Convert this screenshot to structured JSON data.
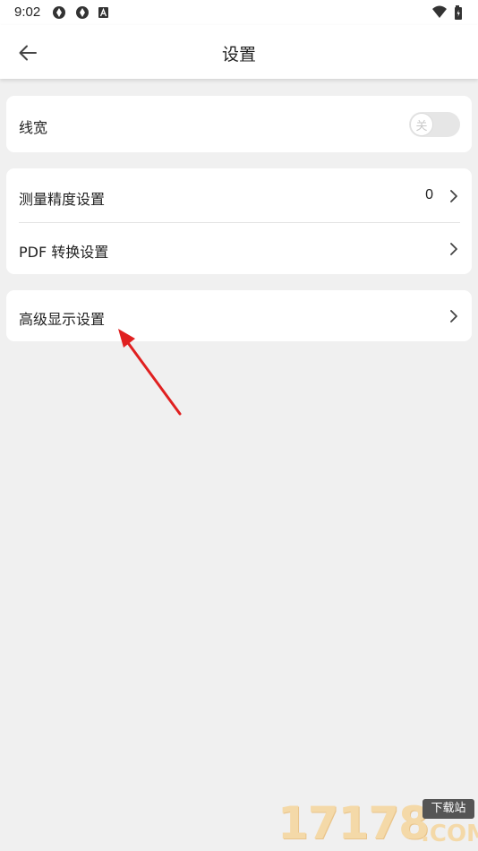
{
  "status_bar": {
    "time": "9:02",
    "icons": [
      "sync-icon",
      "sync-icon",
      "font-icon"
    ],
    "right_icons": [
      "wifi-icon",
      "battery-icon"
    ]
  },
  "app_bar": {
    "back_icon": "arrow-left-icon",
    "title": "设置"
  },
  "groups": [
    {
      "rows": [
        {
          "label": "线宽",
          "control": "toggle",
          "toggle_label": "关",
          "toggle_on": false
        }
      ]
    },
    {
      "rows": [
        {
          "label": "测量精度设置",
          "value": "0",
          "control": "chevron"
        },
        {
          "label": "PDF 转换设置",
          "control": "chevron"
        }
      ]
    },
    {
      "rows": [
        {
          "label": "高级显示设置",
          "control": "chevron"
        }
      ]
    }
  ],
  "annotation": {
    "arrow_color": "#e02020"
  },
  "watermark": {
    "number": "17178",
    "tag": "下载站",
    "domain": ".COM"
  },
  "colors": {
    "background": "#f0f0f0",
    "card": "#ffffff",
    "divider": "#e3e3e3"
  }
}
